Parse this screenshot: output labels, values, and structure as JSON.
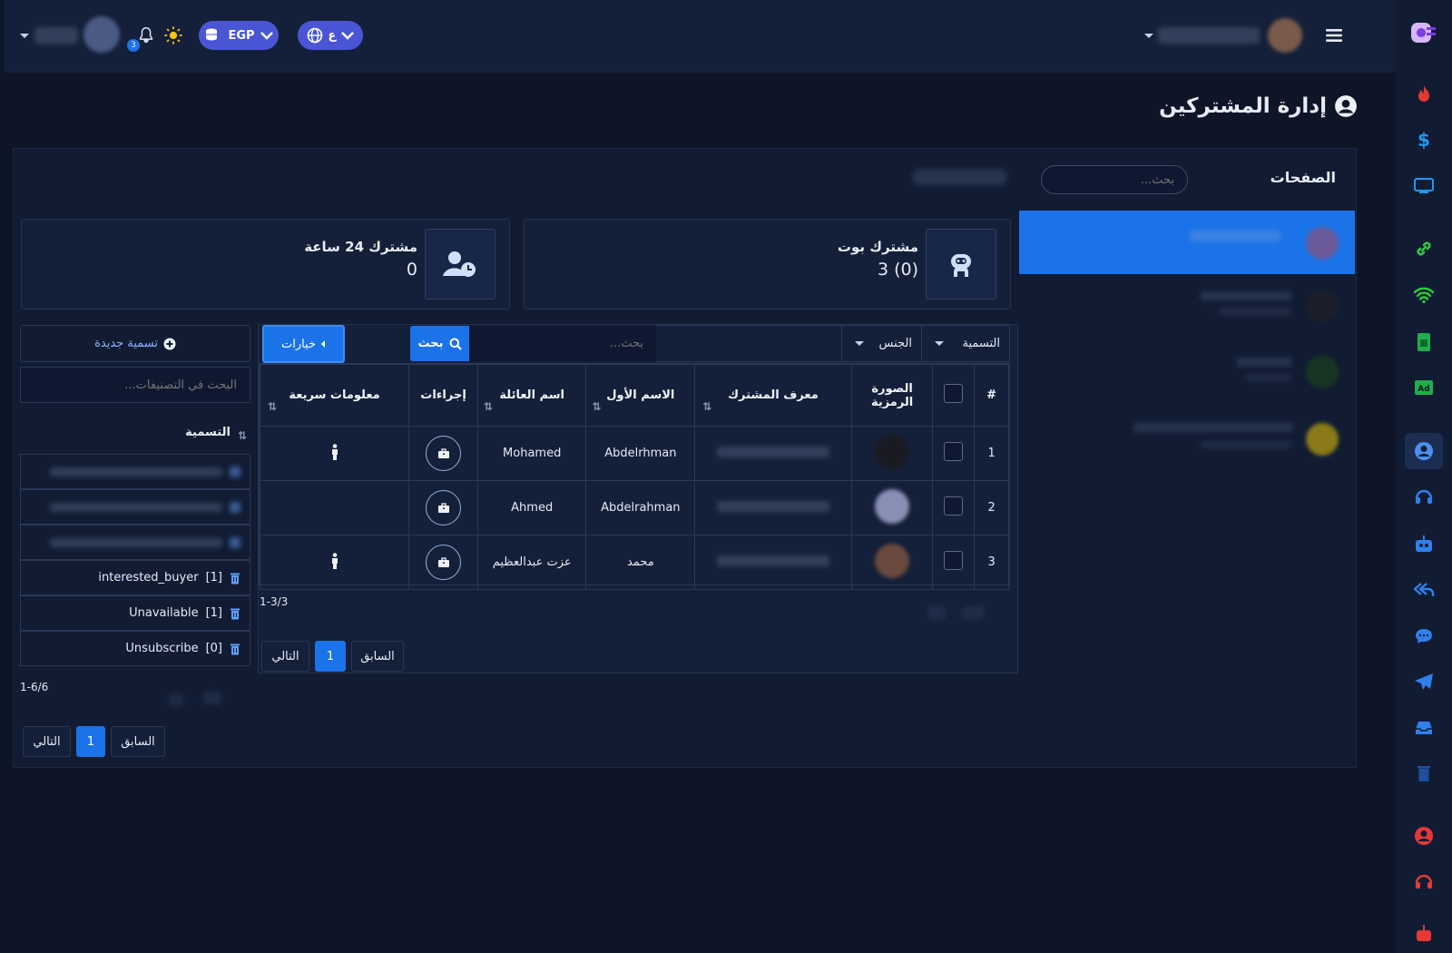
{
  "topbar": {
    "currency": "EGP",
    "language": "ع",
    "notification_count": "3"
  },
  "page": {
    "title": "إدارة المشتركين"
  },
  "pages_panel": {
    "heading": "الصفحات",
    "search_placeholder": "بحث..."
  },
  "stats": {
    "bot": {
      "label": "مشترك بوت",
      "value": "3 (0)"
    },
    "day": {
      "label": "مشترك 24 ساعة",
      "value": "0"
    }
  },
  "filters": {
    "label_select": "التسمية",
    "gender_select": "الجنس",
    "search_placeholder": "بحث...",
    "search_button": "بحث",
    "options_button": "خيارات"
  },
  "table": {
    "headers": {
      "index": "#",
      "avatar": "الصورة الرمزية",
      "subscriber_id": "معرف المشترك",
      "first_name": "الاسم الأول",
      "last_name": "اسم العائلة",
      "actions": "إجراءات",
      "quick_info": "معلومات سريعة"
    },
    "rows": [
      {
        "index": "1",
        "first_name": "Abdelrhman",
        "last_name": "Mohamed"
      },
      {
        "index": "2",
        "first_name": "Abdelrahman",
        "last_name": "Ahmed"
      },
      {
        "index": "3",
        "first_name": "محمد",
        "last_name": "عزت عبدالعظيم"
      }
    ],
    "range": "1-3/3",
    "prev": "السابق",
    "page": "1",
    "next": "التالي"
  },
  "labels_panel": {
    "new_label_button": "تسمية جديدة",
    "search_placeholder": "البحث في التصنيفات...",
    "column": "التسمية",
    "items": [
      {
        "name": "interested_buyer",
        "count": "[1]"
      },
      {
        "name": "Unavailable",
        "count": "[1]"
      },
      {
        "name": "Unsubscribe",
        "count": "[0]"
      }
    ],
    "range": "1-6/6",
    "prev": "السابق",
    "page": "1",
    "next": "التالي"
  },
  "colors": {
    "background": "#0d1527",
    "accent": "#1a73e8",
    "pill": "#4a55d6"
  }
}
